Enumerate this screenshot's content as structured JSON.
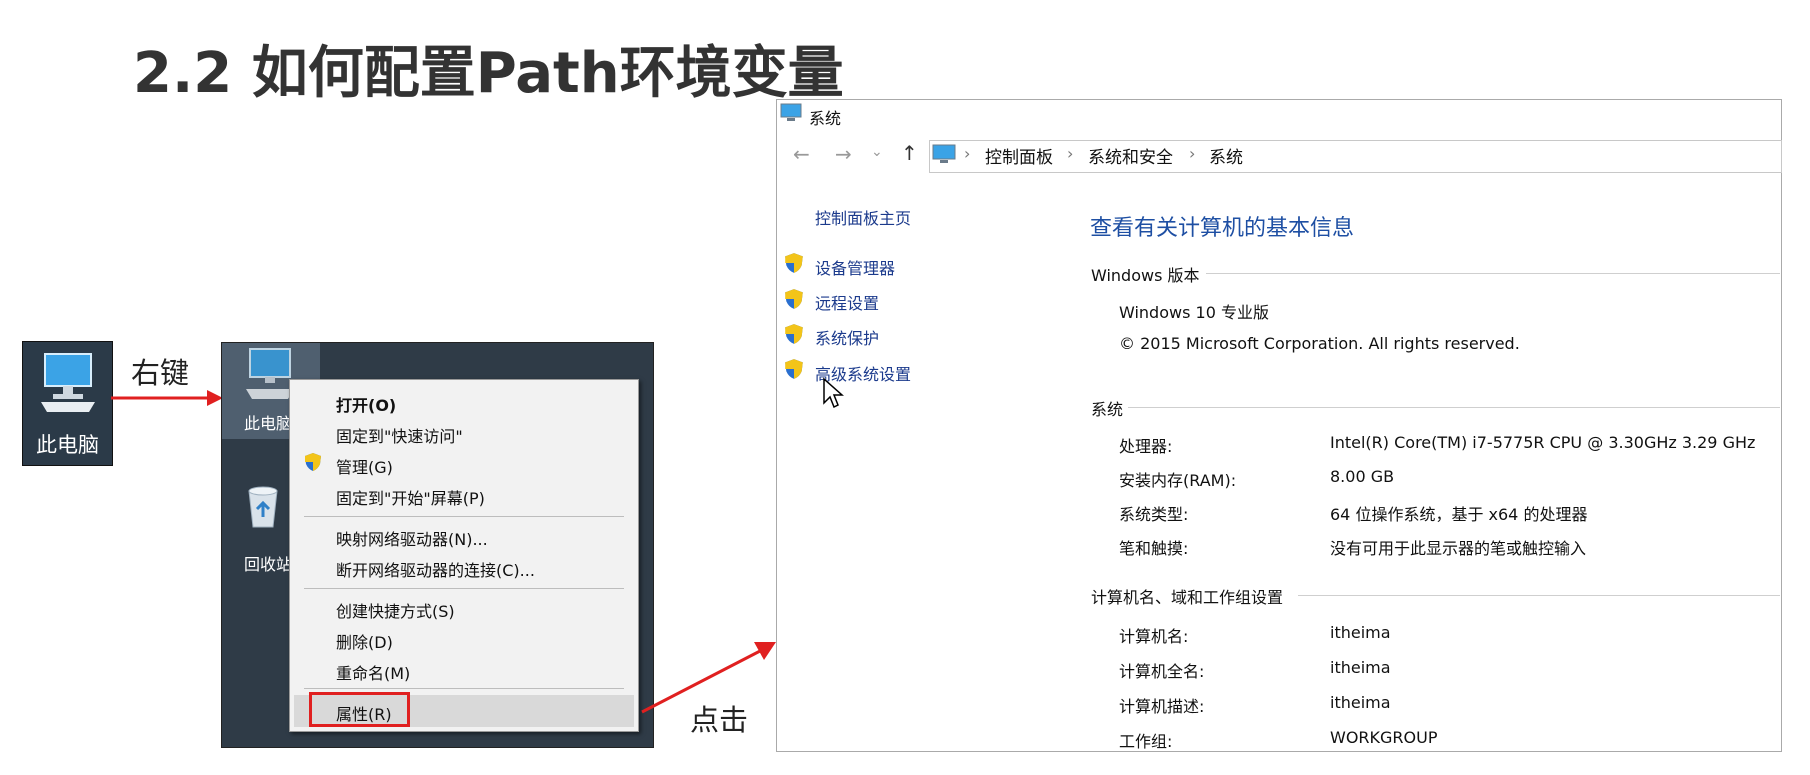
{
  "slide": {
    "title": "2.2 如何配置Path环境变量"
  },
  "step1": {
    "icon_label": "此电脑",
    "arrow_label": "右键"
  },
  "desktop": {
    "pc_label": "此电脑",
    "bin_label": "回收站"
  },
  "context_menu": {
    "items": [
      "打开(O)",
      "固定到\"快速访问\"",
      "管理(G)",
      "固定到\"开始\"屏幕(P)",
      "映射网络驱动器(N)...",
      "断开网络驱动器的连接(C)...",
      "创建快捷方式(S)",
      "删除(D)",
      "重命名(M)",
      "属性(R)"
    ]
  },
  "step2": {
    "arrow_label": "点击"
  },
  "system_window": {
    "title": "系统",
    "breadcrumbs": [
      "控制面板",
      "系统和安全",
      "系统"
    ],
    "sidebar": {
      "home": "控制面板主页",
      "links": [
        "设备管理器",
        "远程设置",
        "系统保护",
        "高级系统设置"
      ]
    },
    "heading": "查看有关计算机的基本信息",
    "windows_section": {
      "title": "Windows 版本",
      "edition": "Windows 10 专业版",
      "copyright": "© 2015 Microsoft Corporation. All rights reserved."
    },
    "system_section": {
      "title": "系统",
      "rows": [
        {
          "key": "处理器:",
          "value": "Intel(R) Core(TM) i7-5775R CPU @ 3.30GHz   3.29 GHz"
        },
        {
          "key": "安装内存(RAM):",
          "value": "8.00 GB"
        },
        {
          "key": "系统类型:",
          "value": "64 位操作系统，基于 x64 的处理器"
        },
        {
          "key": "笔和触摸:",
          "value": "没有可用于此显示器的笔或触控输入"
        }
      ]
    },
    "computer_section": {
      "title": "计算机名、域和工作组设置",
      "rows": [
        {
          "key": "计算机名:",
          "value": "itheima"
        },
        {
          "key": "计算机全名:",
          "value": "itheima"
        },
        {
          "key": "计算机描述:",
          "value": "itheima"
        },
        {
          "key": "工作组:",
          "value": "WORKGROUP"
        }
      ]
    }
  },
  "colors": {
    "accent_red": "#e02020",
    "link_blue": "#1b3a8c",
    "heading_blue": "#1e4fa3"
  }
}
